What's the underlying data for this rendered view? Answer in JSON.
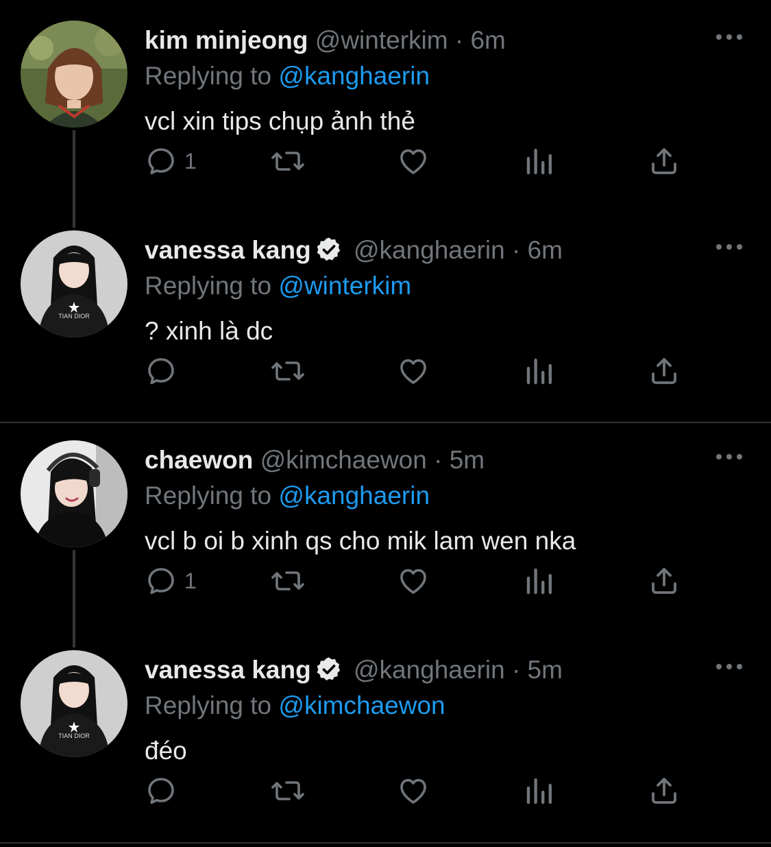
{
  "tweets": [
    {
      "name": "kim minjeong",
      "handle": "@winterkim",
      "separator": "·",
      "time": "6m",
      "verified": false,
      "replying_prefix": "Replying to",
      "replying_to": "@kanghaerin",
      "text": "vcl xin tips chụp ảnh thẻ",
      "reply_count": "1",
      "avatar_icon": "avatar-photo"
    },
    {
      "name": "vanessa kang",
      "handle": "@kanghaerin",
      "separator": "·",
      "time": "6m",
      "verified": true,
      "replying_prefix": "Replying to",
      "replying_to": "@winterkim",
      "text": "? xinh là dc",
      "reply_count": "",
      "avatar_icon": "avatar-photo"
    },
    {
      "name": "chaewon",
      "handle": "@kimchaewon",
      "separator": "·",
      "time": "5m",
      "verified": false,
      "replying_prefix": "Replying to",
      "replying_to": "@kanghaerin",
      "text": "vcl b oi b xinh qs cho mik lam wen nka",
      "reply_count": "1",
      "avatar_icon": "avatar-photo"
    },
    {
      "name": "vanessa kang",
      "handle": "@kanghaerin",
      "separator": "·",
      "time": "5m",
      "verified": true,
      "replying_prefix": "Replying to",
      "replying_to": "@kimchaewon",
      "text": "đéo",
      "reply_count": "",
      "avatar_icon": "avatar-photo"
    }
  ],
  "colors": {
    "background": "#000000",
    "primary_text": "#e7e9ea",
    "secondary_text": "#71767b",
    "link": "#1d9bf0",
    "divider": "#2f3336"
  },
  "icons": [
    "reply-icon",
    "retweet-icon",
    "like-icon",
    "views-icon",
    "share-icon",
    "more-icon",
    "verified-icon"
  ]
}
